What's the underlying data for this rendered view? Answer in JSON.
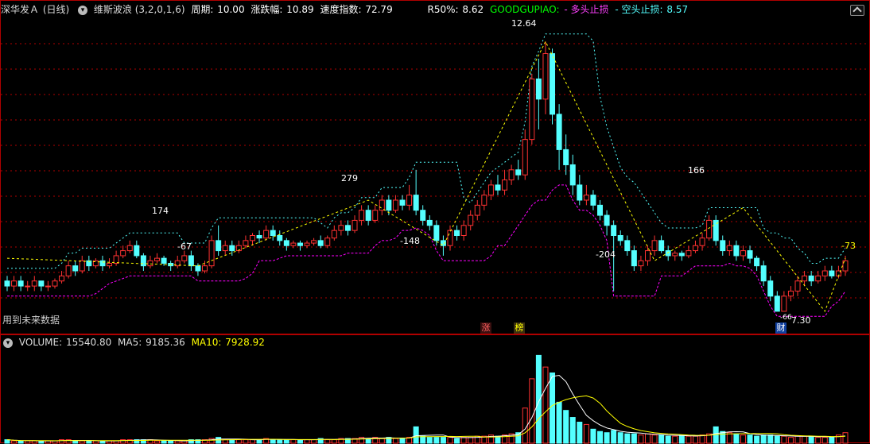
{
  "header": {
    "stock_name": "深华发Ａ",
    "period": "(日线)",
    "indicator_name": "维斯波浪",
    "indicator_params": "(3,2,0,1,6)",
    "cycle_label": "周期:",
    "cycle_value": "10.00",
    "change_label": "涨跌幅:",
    "change_value": "10.89",
    "speed_label": "速度指数:",
    "speed_value": "72.79",
    "r50_label": "R50%:",
    "r50_value": "8.62",
    "brand": "GOODGUPIAO:",
    "long_stop_label": "- 多头止损",
    "short_stop_label": "- 空头止损:",
    "short_stop_value": "8.57"
  },
  "main_chart": {
    "wave_labels": [
      {
        "text": "12.64",
        "color": "#ffffff"
      },
      {
        "text": "279",
        "color": "#ffffff"
      },
      {
        "text": "174",
        "color": "#ffffff"
      },
      {
        "text": "-67",
        "color": "#ffffff"
      },
      {
        "text": "-148",
        "color": "#ffffff"
      },
      {
        "text": "-204",
        "color": "#ffffff"
      },
      {
        "text": "166",
        "color": "#ffffff"
      },
      {
        "text": "-73",
        "color": "#ffff00"
      },
      {
        "text": "7.30",
        "color": "#ffffff"
      },
      {
        "text": "-66",
        "color": "#ffffff"
      }
    ],
    "future_data_note": "用到未来数据",
    "event_tags": [
      {
        "text": "涨",
        "color": "#ff6060"
      },
      {
        "text": "榜",
        "color": "#ffff00"
      },
      {
        "text": "财",
        "color": "#ffffff"
      }
    ]
  },
  "volume_panel": {
    "label": "VOLUME:",
    "volume_value": "15540.80",
    "ma5_label": "MA5:",
    "ma5_value": "9185.36",
    "ma10_label": "MA10:",
    "ma10_value": "7928.92"
  },
  "colors": {
    "up": "#ff3232",
    "down": "#54ffff",
    "zigzag": "#ffff00",
    "long_stop": "#ff00ff",
    "short_stop": "#54ffff",
    "grid": "#b00000",
    "brand": "#00ff00",
    "ma10": "#ffff00"
  },
  "chart_data": {
    "type": "candlestick",
    "candles": [
      [
        7.9,
        7.8,
        8.0,
        7.7
      ],
      [
        7.8,
        7.9,
        8.0,
        7.7
      ],
      [
        7.9,
        7.8,
        8.0,
        7.7
      ],
      [
        7.8,
        7.8,
        7.9,
        7.7
      ],
      [
        7.8,
        7.9,
        8.0,
        7.7
      ],
      [
        7.9,
        7.8,
        7.9,
        7.7
      ],
      [
        7.8,
        7.8,
        7.9,
        7.7
      ],
      [
        7.8,
        7.9,
        7.95,
        7.75
      ],
      [
        7.9,
        8.0,
        8.1,
        7.85
      ],
      [
        8.0,
        8.2,
        8.3,
        7.95
      ],
      [
        8.2,
        8.1,
        8.3,
        8.0
      ],
      [
        8.1,
        8.3,
        8.4,
        8.05
      ],
      [
        8.3,
        8.2,
        8.4,
        8.1
      ],
      [
        8.2,
        8.3,
        8.35,
        8.15
      ],
      [
        8.3,
        8.2,
        8.4,
        8.1
      ],
      [
        8.2,
        8.25,
        8.35,
        8.15
      ],
      [
        8.25,
        8.4,
        8.5,
        8.2
      ],
      [
        8.4,
        8.5,
        8.6,
        8.35
      ],
      [
        8.5,
        8.6,
        8.7,
        8.45
      ],
      [
        8.6,
        8.4,
        8.7,
        8.35
      ],
      [
        8.4,
        8.2,
        8.45,
        8.1
      ],
      [
        8.2,
        8.3,
        8.4,
        8.15
      ],
      [
        8.3,
        8.35,
        8.45,
        8.25
      ],
      [
        8.35,
        8.25,
        8.4,
        8.2
      ],
      [
        8.25,
        8.2,
        8.3,
        8.1
      ],
      [
        8.2,
        8.3,
        8.4,
        8.15
      ],
      [
        8.3,
        8.4,
        8.5,
        8.25
      ],
      [
        8.4,
        8.2,
        8.5,
        8.1
      ],
      [
        8.2,
        8.1,
        8.25,
        8.0
      ],
      [
        8.1,
        8.2,
        8.3,
        8.05
      ],
      [
        8.2,
        8.7,
        8.8,
        8.15
      ],
      [
        8.7,
        8.5,
        9.0,
        8.4
      ],
      [
        8.5,
        8.6,
        8.7,
        8.4
      ],
      [
        8.6,
        8.5,
        8.7,
        8.4
      ],
      [
        8.5,
        8.6,
        8.7,
        8.45
      ],
      [
        8.6,
        8.7,
        8.8,
        8.55
      ],
      [
        8.7,
        8.8,
        8.85,
        8.6
      ],
      [
        8.8,
        8.75,
        8.9,
        8.65
      ],
      [
        8.75,
        8.9,
        9.0,
        8.7
      ],
      [
        8.9,
        8.8,
        9.0,
        8.7
      ],
      [
        8.8,
        8.7,
        8.9,
        8.6
      ],
      [
        8.7,
        8.6,
        8.75,
        8.5
      ],
      [
        8.6,
        8.65,
        8.7,
        8.55
      ],
      [
        8.65,
        8.6,
        8.7,
        8.5
      ],
      [
        8.6,
        8.65,
        8.7,
        8.55
      ],
      [
        8.65,
        8.7,
        8.75,
        8.6
      ],
      [
        8.7,
        8.6,
        8.8,
        8.55
      ],
      [
        8.6,
        8.75,
        8.8,
        8.55
      ],
      [
        8.75,
        8.9,
        9.0,
        8.7
      ],
      [
        8.9,
        9.0,
        9.1,
        8.8
      ],
      [
        9.0,
        8.9,
        9.1,
        8.8
      ],
      [
        8.9,
        9.1,
        9.2,
        8.85
      ],
      [
        9.1,
        9.3,
        9.4,
        9.0
      ],
      [
        9.3,
        9.1,
        9.4,
        9.0
      ],
      [
        9.1,
        9.3,
        9.4,
        9.05
      ],
      [
        9.3,
        9.5,
        9.6,
        9.2
      ],
      [
        9.5,
        9.3,
        9.6,
        9.2
      ],
      [
        9.3,
        9.5,
        9.6,
        9.25
      ],
      [
        9.5,
        9.4,
        9.6,
        9.3
      ],
      [
        9.4,
        9.6,
        9.8,
        9.3
      ],
      [
        9.6,
        9.3,
        10.1,
        9.2
      ],
      [
        9.3,
        9.1,
        9.4,
        9.0
      ],
      [
        9.1,
        9.0,
        9.2,
        8.9
      ],
      [
        9.0,
        8.7,
        9.1,
        8.6
      ],
      [
        8.7,
        8.6,
        8.8,
        8.4
      ],
      [
        8.6,
        8.9,
        9.0,
        8.5
      ],
      [
        8.9,
        8.8,
        9.0,
        8.7
      ],
      [
        8.8,
        9.0,
        9.1,
        8.7
      ],
      [
        9.0,
        9.2,
        9.3,
        8.9
      ],
      [
        9.2,
        9.4,
        9.5,
        9.1
      ],
      [
        9.4,
        9.6,
        9.7,
        9.3
      ],
      [
        9.6,
        9.8,
        9.9,
        9.5
      ],
      [
        9.8,
        9.7,
        10.0,
        9.6
      ],
      [
        9.7,
        9.9,
        10.1,
        9.6
      ],
      [
        9.9,
        10.1,
        10.2,
        9.8
      ],
      [
        10.1,
        10.0,
        10.3,
        9.9
      ],
      [
        10.0,
        10.7,
        10.9,
        9.9
      ],
      [
        10.7,
        11.9,
        12.0,
        10.6
      ],
      [
        11.9,
        11.5,
        12.3,
        10.9
      ],
      [
        11.5,
        12.4,
        12.64,
        11.2
      ],
      [
        12.4,
        11.2,
        12.5,
        11.0
      ],
      [
        11.2,
        10.5,
        11.4,
        10.1
      ],
      [
        10.5,
        10.2,
        10.8,
        10.0
      ],
      [
        10.2,
        9.8,
        10.4,
        9.6
      ],
      [
        9.8,
        9.5,
        10.0,
        9.4
      ],
      [
        9.5,
        9.6,
        9.8,
        9.4
      ],
      [
        9.6,
        9.4,
        9.7,
        9.3
      ],
      [
        9.4,
        9.2,
        9.5,
        9.1
      ],
      [
        9.2,
        9.0,
        9.3,
        8.8
      ],
      [
        9.0,
        8.8,
        9.1,
        7.7
      ],
      [
        8.8,
        8.7,
        8.9,
        8.6
      ],
      [
        8.7,
        8.5,
        8.8,
        8.4
      ],
      [
        8.5,
        8.2,
        8.6,
        8.1
      ],
      [
        8.2,
        8.3,
        8.4,
        8.1
      ],
      [
        8.3,
        8.5,
        8.6,
        8.2
      ],
      [
        8.5,
        8.7,
        8.8,
        8.4
      ],
      [
        8.7,
        8.5,
        8.8,
        8.45
      ],
      [
        8.5,
        8.4,
        8.6,
        8.3
      ],
      [
        8.4,
        8.45,
        8.5,
        8.3
      ],
      [
        8.45,
        8.4,
        8.5,
        8.3
      ],
      [
        8.4,
        8.5,
        8.6,
        8.35
      ],
      [
        8.5,
        8.6,
        8.7,
        8.45
      ],
      [
        8.6,
        8.75,
        8.85,
        8.5
      ],
      [
        8.75,
        9.1,
        9.2,
        8.7
      ],
      [
        9.1,
        8.7,
        9.2,
        8.6
      ],
      [
        8.7,
        8.5,
        8.8,
        8.4
      ],
      [
        8.5,
        8.6,
        8.7,
        8.4
      ],
      [
        8.6,
        8.4,
        8.7,
        8.3
      ],
      [
        8.4,
        8.5,
        8.6,
        8.3
      ],
      [
        8.5,
        8.35,
        8.6,
        8.25
      ],
      [
        8.35,
        8.2,
        8.4,
        8.1
      ],
      [
        8.2,
        7.9,
        8.3,
        7.8
      ],
      [
        7.9,
        7.6,
        8.0,
        7.5
      ],
      [
        7.6,
        7.3,
        7.7,
        7.3
      ],
      [
        7.3,
        7.6,
        7.7,
        7.3
      ],
      [
        7.6,
        7.7,
        7.8,
        7.5
      ],
      [
        7.7,
        7.9,
        8.0,
        7.6
      ],
      [
        7.9,
        8.0,
        8.1,
        7.8
      ],
      [
        8.0,
        7.9,
        8.1,
        7.8
      ],
      [
        7.9,
        8.0,
        8.1,
        7.85
      ],
      [
        8.0,
        8.1,
        8.2,
        7.9
      ],
      [
        8.1,
        8.0,
        8.2,
        7.95
      ],
      [
        8.0,
        8.1,
        8.2,
        7.95
      ],
      [
        8.1,
        8.3,
        8.4,
        8.0
      ]
    ],
    "volumes": [
      3,
      2,
      2,
      2,
      2,
      2,
      2,
      2,
      3,
      3,
      2,
      2,
      2,
      2,
      2,
      2,
      2,
      3,
      3,
      3,
      3,
      3,
      2,
      2,
      2,
      2,
      2,
      3,
      3,
      3,
      4,
      5,
      3,
      3,
      3,
      3,
      3,
      3,
      4,
      3,
      3,
      3,
      3,
      3,
      3,
      3,
      4,
      3,
      3,
      4,
      4,
      4,
      5,
      4,
      5,
      4,
      5,
      4,
      4,
      5,
      14,
      6,
      5,
      5,
      5,
      5,
      4,
      5,
      5,
      6,
      6,
      7,
      6,
      7,
      8,
      9,
      30,
      55,
      75,
      65,
      60,
      35,
      28,
      22,
      18,
      16,
      12,
      10,
      9,
      11,
      9,
      8,
      8,
      7,
      8,
      7,
      7,
      6,
      6,
      7,
      6,
      6,
      7,
      8,
      14,
      10,
      9,
      8,
      7,
      7,
      6,
      7,
      7,
      6,
      6,
      5,
      6,
      6,
      6,
      5,
      5,
      5,
      7,
      9
    ],
    "zigzag_values": [
      8.35,
      8.2,
      9.5,
      8.6,
      12.64,
      8.3,
      9.35,
      7.3,
      8.35
    ],
    "short_stop_value": 8.57,
    "ylim": [
      7.0,
      13.1
    ],
    "grid": true
  }
}
